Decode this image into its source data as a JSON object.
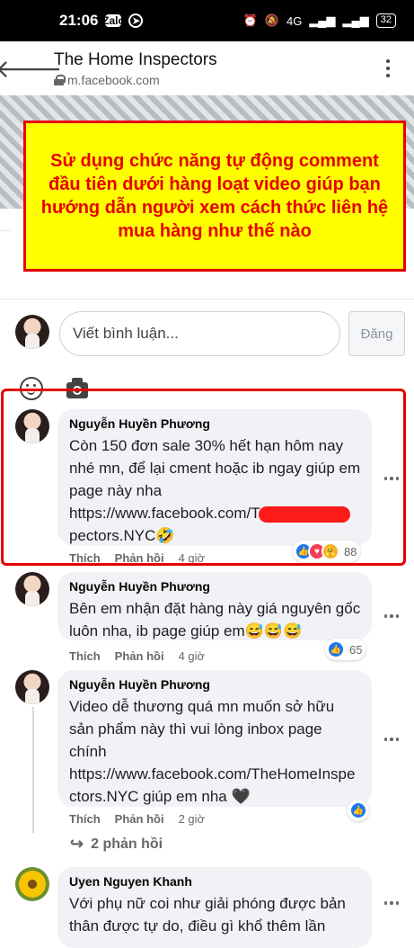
{
  "status_bar": {
    "time": "21:06",
    "zalo": "Zalo",
    "signal": "4G",
    "battery": "32"
  },
  "header": {
    "title": "The Home Inspectors",
    "url": "m.facebook.com"
  },
  "banner": {
    "text": "Sử dụng chức năng tự động comment đầu tiên dưới hàng loạt video giúp bạn hướng dẫn người xem cách thức liên hệ mua hàng như thế nào"
  },
  "composer": {
    "placeholder": "Viết bình luận...",
    "post_label": "Đăng"
  },
  "comments": [
    {
      "author": "Nguyễn Huyền Phương",
      "text_main": "Còn 150 đơn sale 30% hết hạn hôm nay nhé mn, để lại cment hoặc ib ngay giúp em page này nha",
      "text_link_start": "https://www.facebook.com/T",
      "text_link_end": "pectors.NYC🤣",
      "like": "Thích",
      "reply": "Phản hồi",
      "time": "4 giờ",
      "reaction_count": "88"
    },
    {
      "author": "Nguyễn Huyền Phương",
      "text": "Bên em nhận đặt hàng này giá nguyên gốc luôn nha, ib page giúp em😅😅😅",
      "like": "Thích",
      "reply": "Phản hồi",
      "time": "4 giờ",
      "reaction_count": "65"
    },
    {
      "author": "Nguyễn Huyền Phương",
      "text": "Video dễ thương quá mn muốn sở hữu sản phẩm này thì vui lòng inbox page chính https://www.facebook.com/TheHomeInspectors.NYC giúp em nha 🖤",
      "like": "Thích",
      "reply": "Phản hồi",
      "time": "2 giờ",
      "replies_link": "2 phản hồi"
    },
    {
      "author": "Uyen Nguyen Khanh",
      "text": "Với phụ nữ coi như giải phóng được bản thân được tự do, điều gì khổ thêm lần"
    }
  ],
  "colors": {
    "highlight": "#e60000",
    "banner_bg": "#ffff00",
    "like_blue": "#1877f2"
  }
}
